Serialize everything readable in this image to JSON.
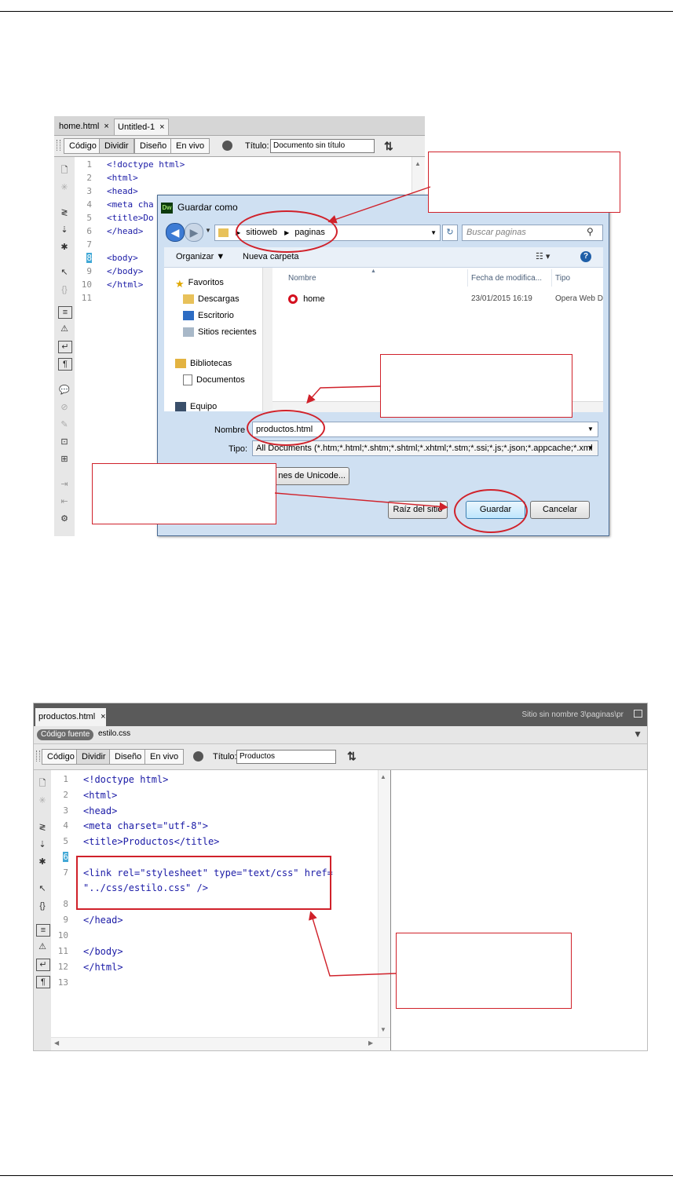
{
  "shot1": {
    "tabs": [
      {
        "label": "home.html",
        "close": "×"
      },
      {
        "label": "Untitled-1",
        "close": "×"
      }
    ],
    "toolbar": {
      "code": "Código",
      "split": "Dividir",
      "design": "Diseño",
      "live": "En vivo",
      "title_label": "Título:",
      "title_value": "Documento sin título"
    },
    "line_numbers": [
      "1",
      "2",
      "3",
      "4",
      "5",
      "6",
      "7",
      "8",
      "9",
      "10",
      "11"
    ],
    "code_lines": [
      "<!doctype html>",
      "<html>",
      "<head>",
      "<meta cha",
      "<title>Do",
      "</head>",
      "",
      "<body>",
      "</body>",
      "</html>",
      ""
    ]
  },
  "dialog": {
    "title": "Guardar como",
    "app_icon": "Dw",
    "breadcrumb": [
      "sitioweb",
      "paginas"
    ],
    "search_placeholder": "Buscar paginas",
    "organize": "Organizar ▼",
    "new_folder": "Nueva carpeta",
    "nav": {
      "favorites": "Favoritos",
      "downloads": "Descargas",
      "desktop": "Escritorio",
      "recent": "Sitios recientes",
      "libraries": "Bibliotecas",
      "documents": "Documentos",
      "computer": "Equipo"
    },
    "columns": {
      "name": "Nombre",
      "date": "Fecha de modifica...",
      "type": "Tipo"
    },
    "files": [
      {
        "name": "home",
        "date": "23/01/2015 16:19",
        "type": "Opera Web D"
      }
    ],
    "name_label": "Nombre",
    "name_value": "productos.html",
    "type_label": "Tipo:",
    "type_value": "All Documents (*.htm;*.html;*.shtm;*.shtml;*.xhtml;*.stm;*.ssi;*.js;*.json;*.appcache;*.xml",
    "unicode_button": "nes de Unicode...",
    "site_root": "Raíz del sitio",
    "save": "Guardar",
    "cancel": "Cancelar"
  },
  "shot2": {
    "tab": {
      "label": "productos.html",
      "close": "×"
    },
    "path": "Sitio sin nombre 3\\paginas\\pr",
    "source_pill": "Código fuente",
    "related_file": "estilo.css",
    "toolbar": {
      "code": "Código",
      "split": "Dividir",
      "design": "Diseño",
      "live": "En vivo",
      "title_label": "Título:",
      "title_value": "Productos"
    },
    "line_numbers": [
      "1",
      "2",
      "3",
      "4",
      "5",
      "6",
      "7",
      "",
      "8",
      "9",
      "10",
      "11",
      "12",
      "13"
    ],
    "code_lines": [
      "<!doctype html>",
      "<html>",
      "<head>",
      "<meta charset=\"utf-8\">",
      "<title>Productos</title>",
      "",
      "<link rel=\"stylesheet\" type=\"text/css\" href=",
      "\"../css/estilo.css\" />",
      "",
      "</head>",
      "",
      "</body>",
      "</html>",
      ""
    ]
  },
  "colors": {
    "annotation_red": "#d0212a",
    "dw_code_blue": "#1a1aa6"
  }
}
